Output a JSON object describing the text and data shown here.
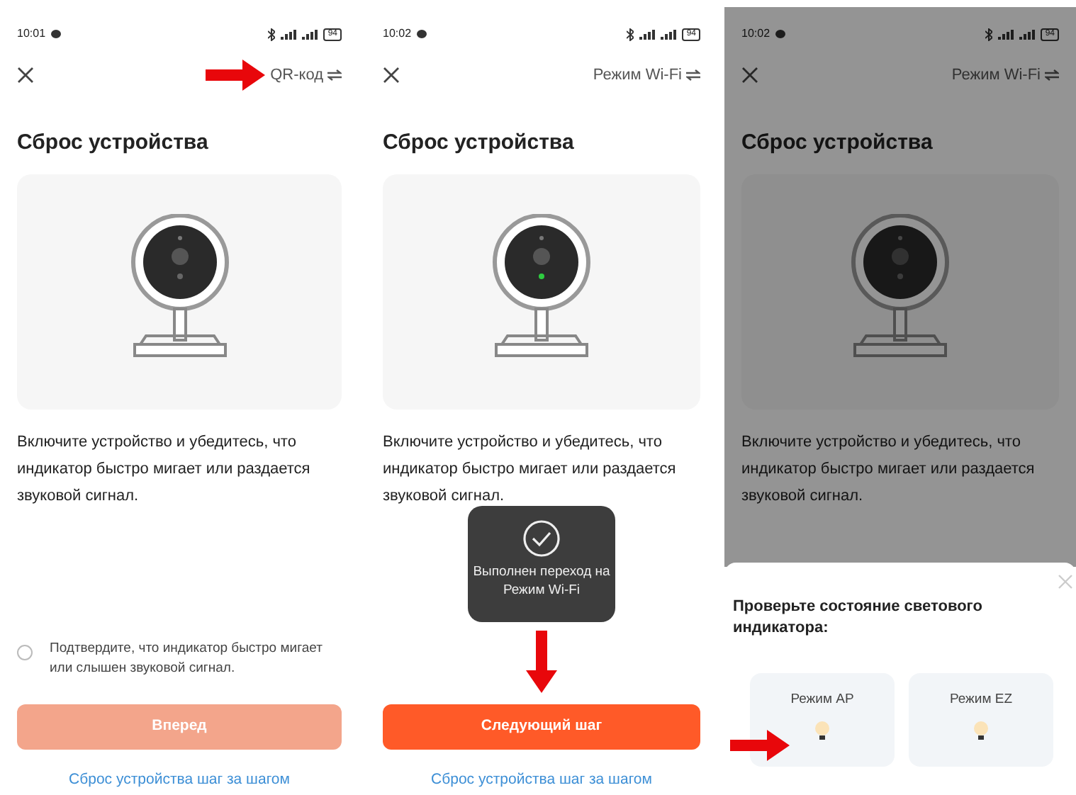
{
  "screens": [
    {
      "status_bar": {
        "time": "10:01",
        "battery": "94"
      },
      "mode_link": {
        "label": "QR-код",
        "annotated": true
      },
      "title": "Сброс устройства",
      "led_on": false,
      "description": "Включите устройство и убедитесь, что индикатор быстро мигает или раздается звуковой сигнал.",
      "confirm": {
        "label": "Подтвердите, что индикатор быстро мигает или слышен звуковой сигнал.",
        "checked": false
      },
      "primary_button": {
        "label": "Вперед",
        "disabled": true,
        "annotated": false
      },
      "help_link": "Сброс устройства шаг за шагом"
    },
    {
      "status_bar": {
        "time": "10:02",
        "battery": "94"
      },
      "mode_link": {
        "label": "Режим Wi-Fi",
        "annotated": false
      },
      "title": "Сброс устройства",
      "led_on": true,
      "description": "Включите устройство и убедитесь, что индикатор быстро мигает или раздается звуковой сигнал.",
      "primary_button": {
        "label": "Следующий шаг",
        "disabled": false,
        "annotated": true
      },
      "help_link": "Сброс устройства шаг за шагом",
      "toast": "Выполнен переход на Режим Wi-Fi"
    },
    {
      "status_bar": {
        "time": "10:02",
        "battery": "94"
      },
      "mode_link": {
        "label": "Режим Wi-Fi",
        "annotated": false
      },
      "title": "Сброс устройства",
      "led_on": false,
      "description": "Включите устройство и убедитесь, что индикатор быстро мигает или раздается звуковой сигнал.",
      "dimmed": true,
      "sheet": {
        "title": "Проверьте состояние светового индикатора:",
        "options": [
          {
            "label": "Режим AP",
            "annotated": true
          },
          {
            "label": "Режим EZ",
            "annotated": false
          }
        ]
      }
    }
  ]
}
